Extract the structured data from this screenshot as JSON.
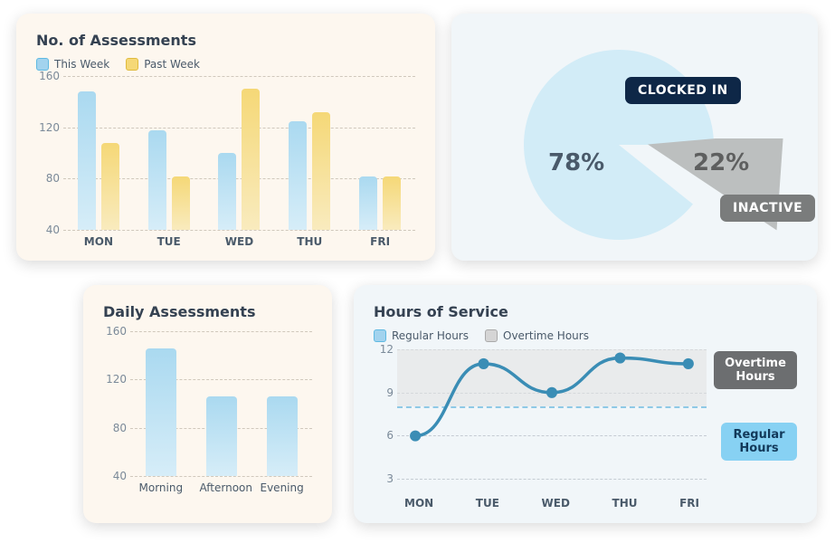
{
  "assessments": {
    "title": "No. of Assessments",
    "legend": [
      {
        "label": "This Week"
      },
      {
        "label": "Past Week"
      }
    ],
    "yticks": [
      160,
      120,
      80,
      40
    ],
    "categories": [
      "MON",
      "TUE",
      "WED",
      "THU",
      "FRI"
    ],
    "this_week": [
      148,
      118,
      100,
      125,
      82
    ],
    "past_week": [
      108,
      82,
      150,
      132,
      82
    ]
  },
  "pie": {
    "labels": {
      "clocked_in": "CLOCKED IN",
      "inactive": "INACTIVE"
    },
    "values": {
      "clocked_in": "78%",
      "inactive": "22%"
    }
  },
  "daily": {
    "title": "Daily Assessments",
    "yticks": [
      160,
      120,
      80,
      40
    ],
    "categories": [
      "Morning",
      "Afternoon",
      "Evening"
    ],
    "values": [
      146,
      106,
      106
    ]
  },
  "hours": {
    "title": "Hours of Service",
    "legend": [
      {
        "label": "Regular Hours"
      },
      {
        "label": "Overtime Hours"
      }
    ],
    "yticks": [
      12,
      9,
      6,
      3
    ],
    "categories": [
      "MON",
      "TUE",
      "WED",
      "THU",
      "FRI"
    ],
    "series": [
      6.0,
      11.0,
      9.0,
      11.4,
      11.0
    ],
    "threshold": 8,
    "badges": {
      "overtime": "Overtime Hours",
      "regular": "Regular Hours"
    }
  },
  "chart_data": [
    {
      "type": "bar",
      "title": "No. of Assessments",
      "categories": [
        "MON",
        "TUE",
        "WED",
        "THU",
        "FRI"
      ],
      "series": [
        {
          "name": "This Week",
          "values": [
            148,
            118,
            100,
            125,
            82
          ]
        },
        {
          "name": "Past Week",
          "values": [
            108,
            82,
            150,
            132,
            82
          ]
        }
      ],
      "ylim": [
        40,
        160
      ],
      "yticks": [
        40,
        80,
        120,
        160
      ]
    },
    {
      "type": "pie",
      "title": "Clock status",
      "series": [
        {
          "name": "Clocked In",
          "value": 78
        },
        {
          "name": "Inactive",
          "value": 22
        }
      ]
    },
    {
      "type": "bar",
      "title": "Daily Assessments",
      "categories": [
        "Morning",
        "Afternoon",
        "Evening"
      ],
      "values": [
        146,
        106,
        106
      ],
      "ylim": [
        40,
        160
      ],
      "yticks": [
        40,
        80,
        120,
        160
      ]
    },
    {
      "type": "line",
      "title": "Hours of Service",
      "categories": [
        "MON",
        "TUE",
        "WED",
        "THU",
        "FRI"
      ],
      "series": [
        {
          "name": "Hours",
          "values": [
            6.0,
            11.0,
            9.0,
            11.4,
            11.0
          ]
        }
      ],
      "ylim": [
        3,
        12
      ],
      "yticks": [
        3,
        6,
        9,
        12
      ],
      "threshold": 8,
      "bands": [
        {
          "name": "Overtime Hours",
          "from": 8,
          "to": 12
        },
        {
          "name": "Regular Hours",
          "from": 3,
          "to": 8
        }
      ]
    }
  ]
}
